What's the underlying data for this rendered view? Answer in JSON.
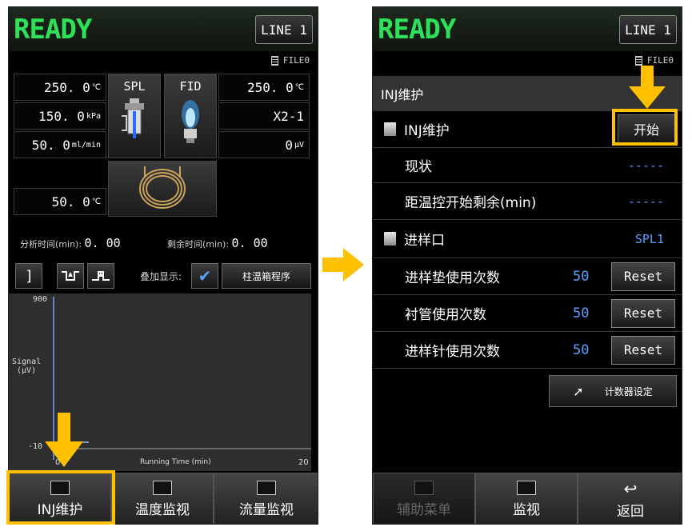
{
  "left": {
    "status": "READY",
    "line": "LINE 1",
    "file": "FILE0",
    "spl_temp": "250. 0",
    "spl_temp_unit": "℃",
    "pressure": "150. 0",
    "pressure_unit": "kPa",
    "flow": "50. 0",
    "flow_unit": "ml/min",
    "spl_label": "SPL",
    "fid_label": "FID",
    "fid_temp": "250. 0",
    "fid_temp_unit": "℃",
    "fid_mode": "X2-1",
    "fid_signal": "0",
    "fid_signal_unit": "μV",
    "column_temp": "50. 0",
    "column_temp_unit": "℃",
    "analysis_time_label": "分析时间(min):",
    "analysis_time": "0. 00",
    "remaining_time_label": "剩余时间(min):",
    "remaining_time": "0. 00",
    "overlay_label": "叠加显示:",
    "oven_program_label": "柱温箱程序",
    "plot": {
      "y_top": "900",
      "y_bottom": "-10",
      "ylabel": "Signal\n(μV)",
      "x_left": "0",
      "x_right": "20",
      "xlabel": "Running Time (min)"
    },
    "tabs": [
      {
        "label": "INJ维护"
      },
      {
        "label": "温度监视"
      },
      {
        "label": "流量监视"
      }
    ]
  },
  "right": {
    "status": "READY",
    "line": "LINE 1",
    "file": "FILE0",
    "header": "INJ维护",
    "inj_maintenance_label": "INJ维护",
    "start_label": "开始",
    "status_label": "现状",
    "status_value": "-----",
    "time_remaining_label": "距温控开始剩余(min)",
    "time_remaining_value": "-----",
    "inlet_label": "进样口",
    "inlet_value": "SPL1",
    "counters": [
      {
        "label": "进样垫使用次数",
        "value": "50",
        "reset": "Reset"
      },
      {
        "label": "衬管使用次数",
        "value": "50",
        "reset": "Reset"
      },
      {
        "label": "进样针使用次数",
        "value": "50",
        "reset": "Reset"
      }
    ],
    "counter_setting_label": "计数器设定",
    "tabs": [
      {
        "label": "辅助菜单"
      },
      {
        "label": "监视"
      },
      {
        "label": "返回"
      }
    ]
  },
  "colors": {
    "ready_green": "#2ee05a",
    "highlight": "#ffc000",
    "value_blue": "#5aa0ff"
  }
}
